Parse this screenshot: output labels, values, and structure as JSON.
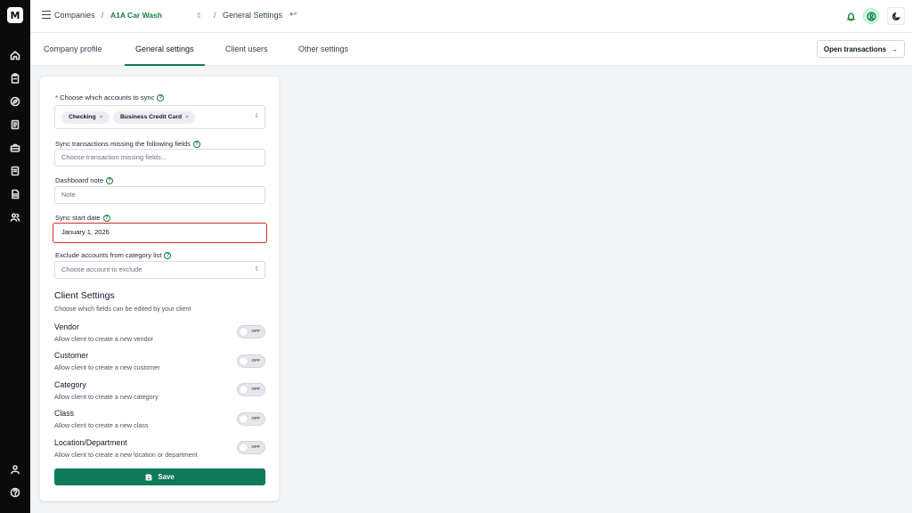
{
  "sidebar": {
    "logo_text": "M",
    "icons": [
      "home-icon",
      "clipboard-icon",
      "compass-icon",
      "receipt-icon",
      "briefcase-icon",
      "document-icon",
      "report-icon",
      "users-icon"
    ],
    "bottom_icons": [
      "user-icon",
      "help-icon"
    ]
  },
  "header": {
    "companies_label": "Companies",
    "sep": "/",
    "company_name": "A1A Car Wash",
    "updown": "⇕",
    "page": "General Settings",
    "back_glyph": "↩"
  },
  "tabs": [
    {
      "label": "Company profile",
      "active": false
    },
    {
      "label": "General settings",
      "active": true
    },
    {
      "label": "Client users",
      "active": false
    },
    {
      "label": "Other settings",
      "active": false
    }
  ],
  "open_transactions": {
    "label": "Open transactions",
    "arrow": "→"
  },
  "form": {
    "accounts": {
      "label": "* Choose which accounts to sync",
      "chips": [
        {
          "label": "Checking"
        },
        {
          "label": "Business Credit Card"
        }
      ],
      "chip_remove": "×"
    },
    "missing_fields": {
      "label": "Sync transactions missing the following fields",
      "placeholder": "Choose transaction missing fields..."
    },
    "dashboard_note": {
      "label": "Dashboard note",
      "placeholder": "Note"
    },
    "sync_start": {
      "label": "Sync start date",
      "value": "January 1, 2026"
    },
    "exclude": {
      "label": "Exclude accounts from category list",
      "placeholder": "Choose account to exclude"
    },
    "help_glyph": "?",
    "chevron": "⇕"
  },
  "client_settings": {
    "title": "Client Settings",
    "subtitle": "Choose which fields can be edited by your client",
    "toggle_text": "OFF",
    "options": [
      {
        "title": "Vendor",
        "desc": "Allow client to create a new vendor"
      },
      {
        "title": "Customer",
        "desc": "Allow client to create a new customer"
      },
      {
        "title": "Category",
        "desc": "Allow client to create a new category"
      },
      {
        "title": "Class",
        "desc": "Allow client to create a new class"
      },
      {
        "title": "Location/Department",
        "desc": "Allow client to create a new location or department"
      }
    ]
  },
  "save_label": "Save",
  "colors": {
    "accent": "#0f7a5a",
    "link_green": "#15803d",
    "focus_red": "#dc2626"
  }
}
